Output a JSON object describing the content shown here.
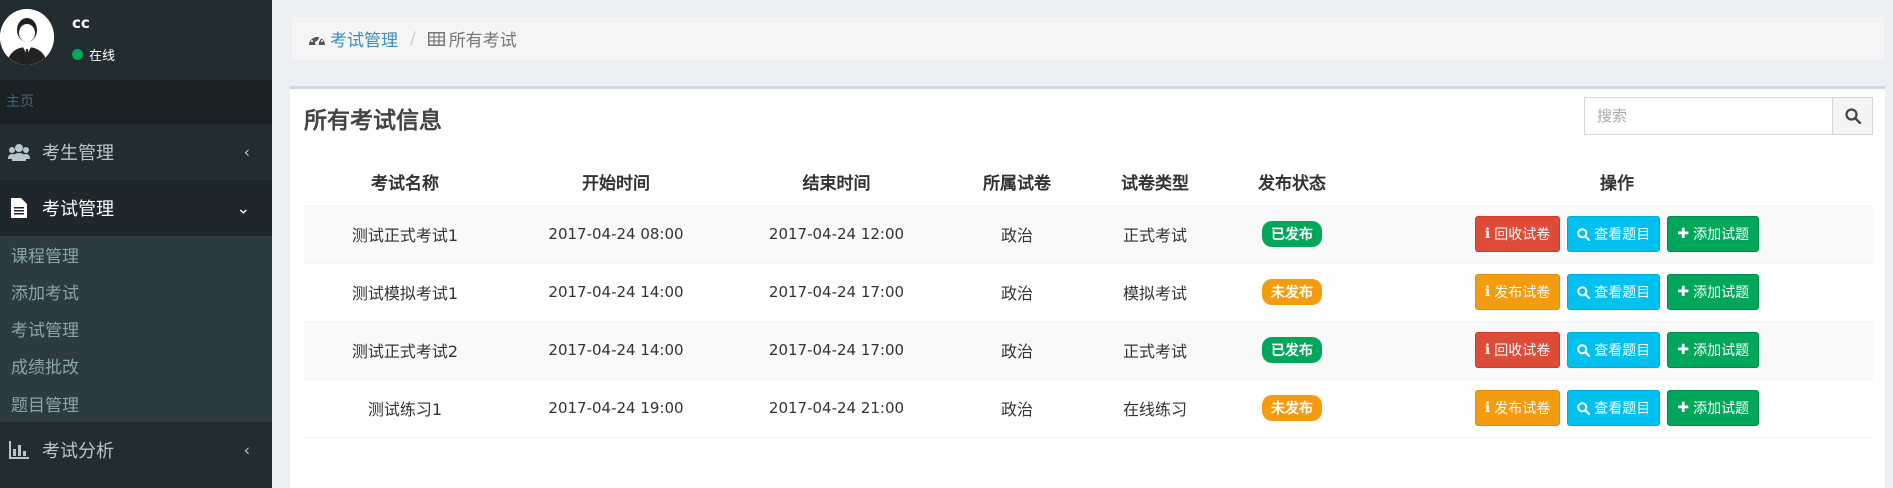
{
  "user": {
    "name": "cc",
    "status": "在线"
  },
  "sidebar": {
    "header": "主页",
    "items": [
      {
        "label": "考生管理",
        "icon": "users-icon",
        "chevron": "‹"
      },
      {
        "label": "考试管理",
        "icon": "file-icon",
        "chevron": "⌄"
      },
      {
        "label": "考试分析",
        "icon": "bar-chart-icon",
        "chevron": "‹"
      }
    ],
    "submenu": [
      "课程管理",
      "添加考试",
      "考试管理",
      "成绩批改",
      "题目管理"
    ]
  },
  "breadcrumb": {
    "parent": "考试管理",
    "separator": "/",
    "current": "所有考试"
  },
  "box": {
    "title": "所有考试信息"
  },
  "search": {
    "placeholder": "搜索"
  },
  "table": {
    "headers": [
      "考试名称",
      "开始时间",
      "结束时间",
      "所属试卷",
      "试卷类型",
      "发布状态",
      "操作"
    ],
    "rows": [
      {
        "name": "测试正式考试1",
        "start": "2017-04-24 08:00",
        "end": "2017-04-24 12:00",
        "paper": "政治",
        "type": "正式考试",
        "status": "已发布",
        "publish_btn": "回收试卷",
        "view_btn": "查看题目",
        "add_btn": "添加试题"
      },
      {
        "name": "测试模拟考试1",
        "start": "2017-04-24 14:00",
        "end": "2017-04-24 17:00",
        "paper": "政治",
        "type": "模拟考试",
        "status": "未发布",
        "publish_btn": "发布试卷",
        "view_btn": "查看题目",
        "add_btn": "添加试题"
      },
      {
        "name": "测试正式考试2",
        "start": "2017-04-24 14:00",
        "end": "2017-04-24 17:00",
        "paper": "政治",
        "type": "正式考试",
        "status": "已发布",
        "publish_btn": "回收试卷",
        "view_btn": "查看题目",
        "add_btn": "添加试题"
      },
      {
        "name": "测试练习1",
        "start": "2017-04-24 19:00",
        "end": "2017-04-24 21:00",
        "paper": "政治",
        "type": "在线练习",
        "status": "未发布",
        "publish_btn": "发布试卷",
        "view_btn": "查看题目",
        "add_btn": "添加试题"
      }
    ]
  },
  "colors": {
    "sidebar_bg": "#222d32",
    "link": "#3c8dbc",
    "published": "#00a65a",
    "unpublished": "#f39c12",
    "danger": "#dd4b39",
    "info": "#00c0ef"
  }
}
